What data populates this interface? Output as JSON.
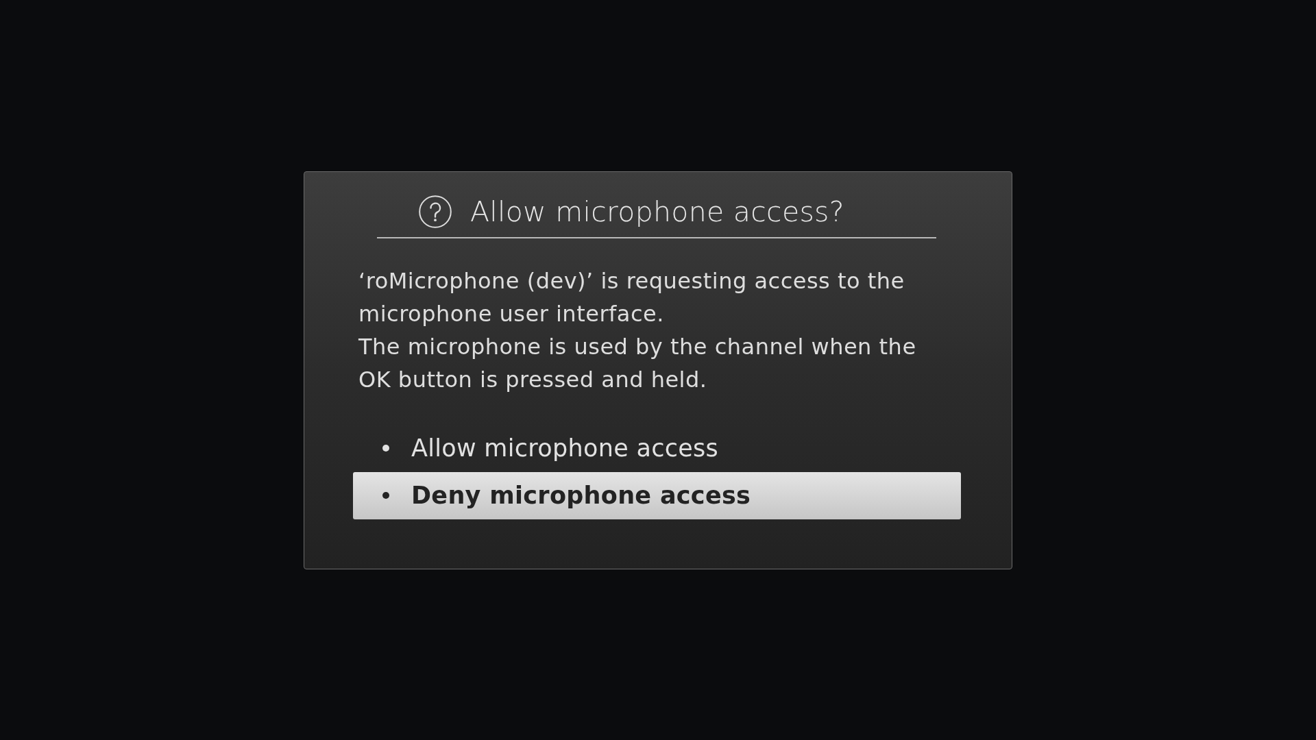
{
  "dialog": {
    "title": "Allow microphone access?",
    "message": [
      "‘roMicrophone (dev)’ is requesting access to the microphone user interface.",
      "The microphone is used by the channel when the OK button is pressed and held."
    ],
    "options": [
      {
        "label": "Allow microphone access",
        "selected": false
      },
      {
        "label": "Deny microphone access",
        "selected": true
      }
    ]
  }
}
